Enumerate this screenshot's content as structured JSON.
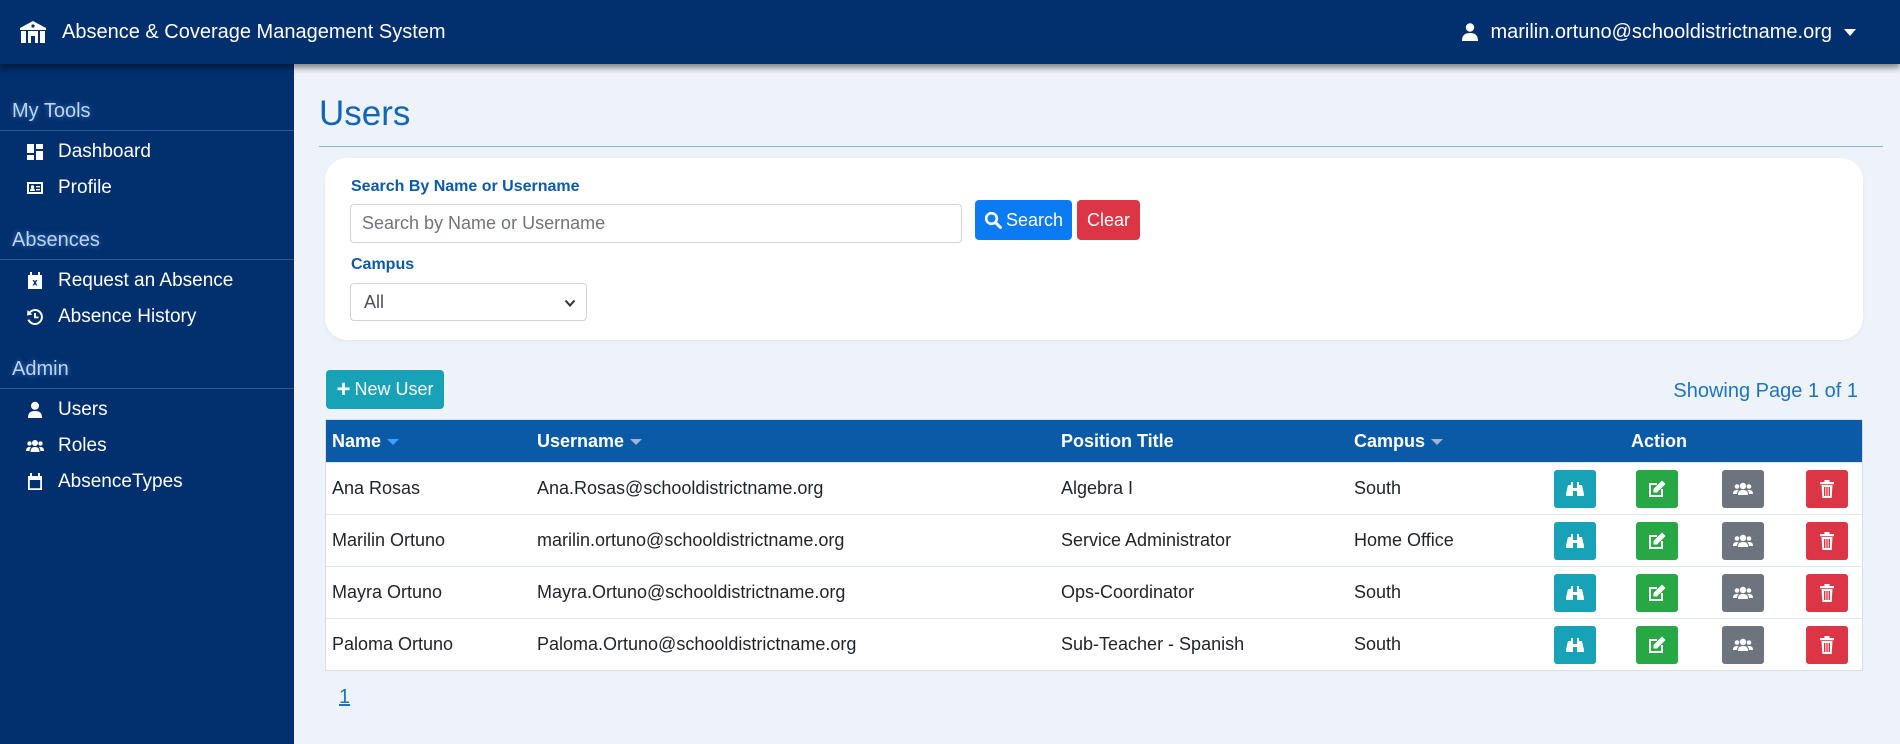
{
  "header": {
    "app_title": "Absence & Coverage Management System",
    "user_email": "marilin.ortuno@schooldistrictname.org"
  },
  "sidebar": {
    "sections": [
      {
        "title": "My Tools",
        "items": [
          {
            "label": "Dashboard",
            "icon": "dashboard-icon"
          },
          {
            "label": "Profile",
            "icon": "id-card-icon"
          }
        ]
      },
      {
        "title": "Absences",
        "items": [
          {
            "label": "Request an Absence",
            "icon": "calendar-x-icon"
          },
          {
            "label": "Absence History",
            "icon": "history-icon"
          }
        ]
      },
      {
        "title": "Admin",
        "items": [
          {
            "label": "Users",
            "icon": "user-icon"
          },
          {
            "label": "Roles",
            "icon": "users-icon"
          },
          {
            "label": "AbsenceTypes",
            "icon": "calendar-icon"
          }
        ]
      }
    ]
  },
  "page": {
    "title": "Users"
  },
  "search": {
    "label": "Search By Name or Username",
    "placeholder": "Search by Name or Username",
    "value": "",
    "search_button": "Search",
    "clear_button": "Clear",
    "campus_label": "Campus",
    "campus_selected": "All"
  },
  "toolbar": {
    "new_user_label": "New User",
    "showing_text": "Showing Page 1 of 1"
  },
  "table": {
    "columns": [
      "Name",
      "Username",
      "Position Title",
      "Campus",
      "Action"
    ],
    "rows": [
      {
        "name": "Ana Rosas",
        "username": "Ana.Rosas@schooldistrictname.org",
        "position": "Algebra I",
        "campus": "South"
      },
      {
        "name": "Marilin Ortuno",
        "username": "marilin.ortuno@schooldistrictname.org",
        "position": "Service Administrator",
        "campus": "Home Office"
      },
      {
        "name": "Mayra Ortuno",
        "username": "Mayra.Ortuno@schooldistrictname.org",
        "position": "Ops-Coordinator",
        "campus": "South"
      },
      {
        "name": "Paloma Ortuno",
        "username": "Paloma.Ortuno@schooldistrictname.org",
        "position": "Sub-Teacher - Spanish",
        "campus": "South"
      }
    ]
  },
  "pagination": {
    "current_page": "1"
  },
  "colors": {
    "navbar": "#022f6e",
    "table_header": "#0b5aa8",
    "primary": "#0b7bf3",
    "danger": "#dc3545",
    "info": "#17a2b8",
    "success": "#28a745",
    "secondary": "#6c757d"
  }
}
